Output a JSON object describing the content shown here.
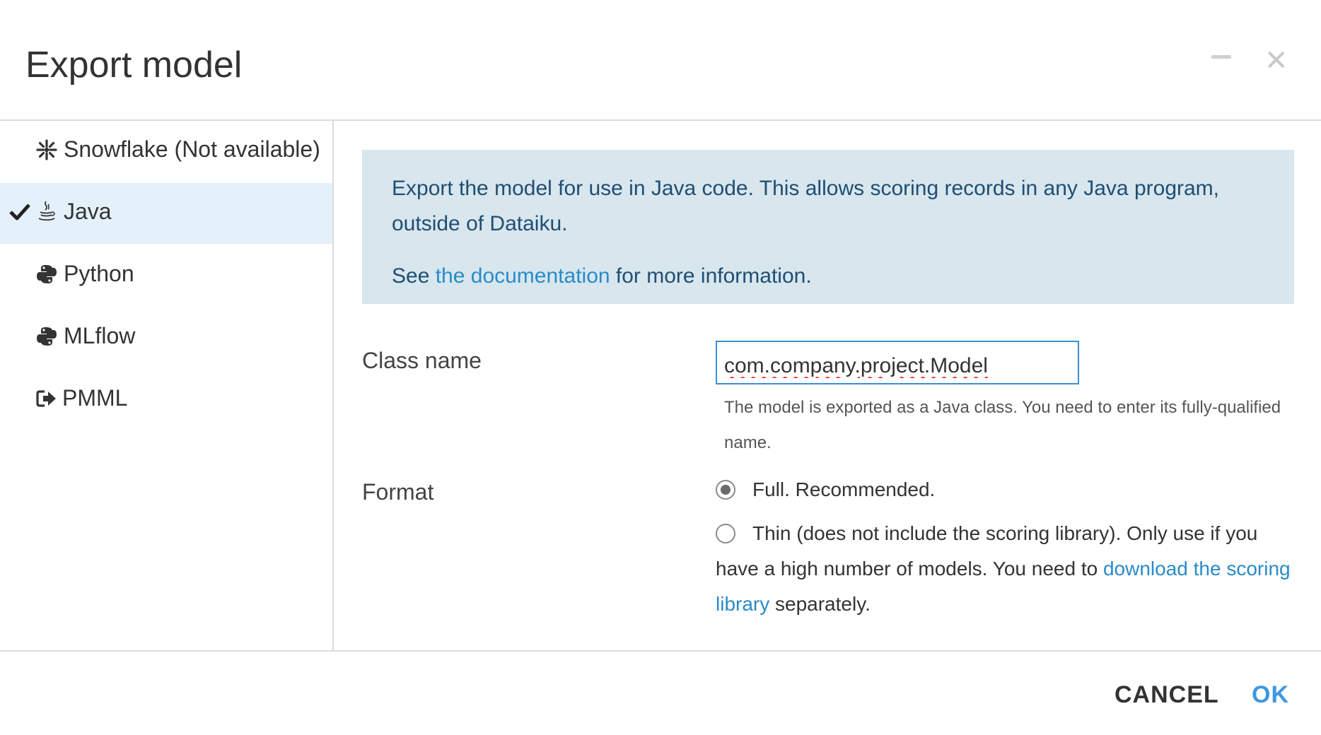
{
  "dialog": {
    "title": "Export model"
  },
  "sidebar": {
    "items": [
      {
        "label": "Snowflake (Not available)",
        "icon": "snowflake-icon",
        "active": false
      },
      {
        "label": "Java",
        "icon": "java-icon",
        "active": true
      },
      {
        "label": "Python",
        "icon": "python-icon",
        "active": false
      },
      {
        "label": "MLflow",
        "icon": "python-icon",
        "active": false
      },
      {
        "label": "PMML",
        "icon": "export-icon",
        "active": false
      }
    ]
  },
  "info": {
    "line1": "Export the model for use in Java code. This allows scoring records in any Java program, outside of Dataiku.",
    "see_prefix": "See ",
    "doc_link": "the documentation",
    "see_suffix": " for more information."
  },
  "form": {
    "class_name_label": "Class name",
    "class_name_value": "com.company.project.Model",
    "class_name_help": "The model is exported as a Java class. You need to enter its fully-qualified name.",
    "format_label": "Format",
    "format_options": [
      {
        "text": "Full. Recommended.",
        "checked": true
      },
      {
        "text_prefix": "Thin (does not include the scoring library). Only use if you have a high number of models. You need to ",
        "link": "download the scoring library",
        "text_suffix": " separately.",
        "checked": false
      }
    ]
  },
  "footer": {
    "cancel_label": "CANCEL",
    "ok_label": "OK"
  },
  "colors": {
    "accent": "#3f97e0",
    "link": "#2a8bc8",
    "info_bg": "#d8e6ee",
    "active_item_bg": "#e4f1fb"
  }
}
